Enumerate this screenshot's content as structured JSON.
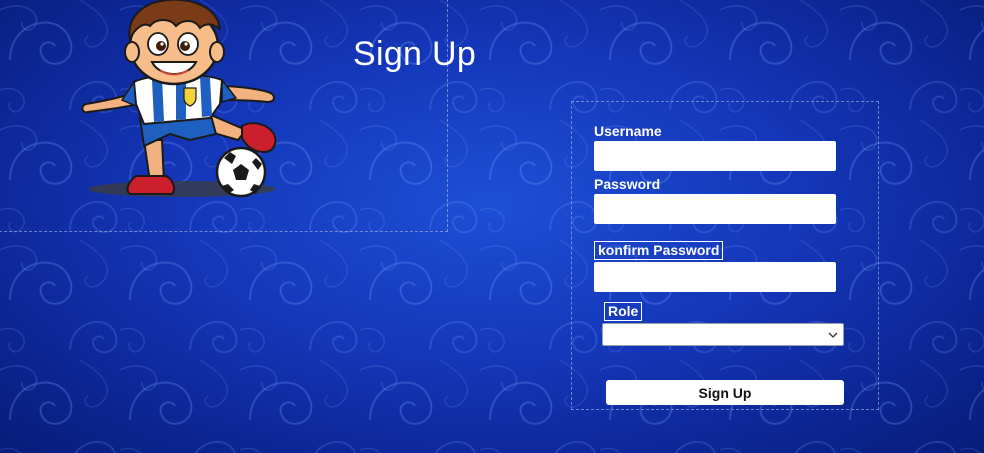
{
  "page": {
    "title": "Sign Up"
  },
  "form": {
    "username_label": "Username",
    "username_value": "",
    "password_label": "Password",
    "password_value": "",
    "confirm_password_label": "konfirm Password",
    "confirm_password_value": "",
    "role_label": "Role",
    "role_selected": "",
    "submit_label": "Sign Up"
  },
  "icons": {
    "mascot": "soccer-player-mascot-icon",
    "dropdown": "chevron-down-icon"
  },
  "colors": {
    "background": "#1436b8",
    "text": "#ffffff",
    "input_background": "#ffffff"
  }
}
